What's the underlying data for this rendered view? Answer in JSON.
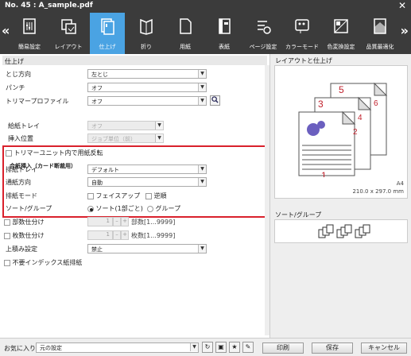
{
  "window": {
    "title": "No. 45 :  A_sample.pdf",
    "close": "✕"
  },
  "toolbar": {
    "left_arrow": "«",
    "right_arrow": "»",
    "tabs": [
      {
        "label": "簡易設定",
        "icon": "quick-setting-icon"
      },
      {
        "label": "レイアウト",
        "icon": "layout-icon"
      },
      {
        "label": "仕上げ",
        "icon": "finishing-icon"
      },
      {
        "label": "折り",
        "icon": "fold-icon"
      },
      {
        "label": "用紙",
        "icon": "paper-icon"
      },
      {
        "label": "表紙",
        "icon": "cover-icon"
      },
      {
        "label": "ページ設定",
        "icon": "page-setting-icon"
      },
      {
        "label": "カラーモード",
        "icon": "color-mode-icon"
      },
      {
        "label": "色変換設定",
        "icon": "color-convert-icon"
      },
      {
        "label": "品質最適化",
        "icon": "quality-icon"
      }
    ]
  },
  "section": {
    "title": "仕上げ"
  },
  "fields": {
    "binding": {
      "label": "とじ方向",
      "value": "左とじ"
    },
    "punch": {
      "label": "パンチ",
      "value": "オフ"
    },
    "trimmer": {
      "label": "トリマープロファイル",
      "value": "オフ"
    },
    "insert_head": "合紙挿入（カード断裁用）",
    "insert_tray": {
      "label": "給紙トレイ",
      "value": "オフ"
    },
    "insert_pos": {
      "label": "挿入位置",
      "value": "ジョブ単位（前）"
    },
    "trim_flip": "トリマーユニット内で用紙反転",
    "output_tray": {
      "label": "排紙トレイ",
      "value": "デフォルト"
    },
    "path": {
      "label": "通紙方向",
      "value": "自動"
    },
    "output_mode": {
      "label": "排紙モード",
      "opt1": "フェイスアップ",
      "opt2": "逆順"
    },
    "sort": {
      "label": "ソート/グループ",
      "opt1": "ソート(1部ごと)",
      "opt2": "グループ"
    },
    "copy_split": {
      "label": "部数仕分け",
      "value": "1",
      "range": "部数[1...9999]"
    },
    "sheet_split": {
      "label": "枚数仕分け",
      "value": "1",
      "range": "枚数[1...9999]"
    },
    "stack": {
      "label": "上積み設定",
      "value": "禁止"
    },
    "unneeded_index": "不要インデックス紙排紙"
  },
  "preview": {
    "title": "レイアウトと仕上げ",
    "pages": [
      "1",
      "2",
      "3",
      "4",
      "5",
      "6"
    ],
    "size_name": "A4",
    "size_dims": "210.0 x 297.0 mm",
    "sort_title": "ソート/グループ"
  },
  "bottom": {
    "favorites_label": "お気に入り",
    "favorites_value": "元の設定",
    "print": "印刷",
    "save": "保存",
    "cancel": "キャンセル"
  }
}
